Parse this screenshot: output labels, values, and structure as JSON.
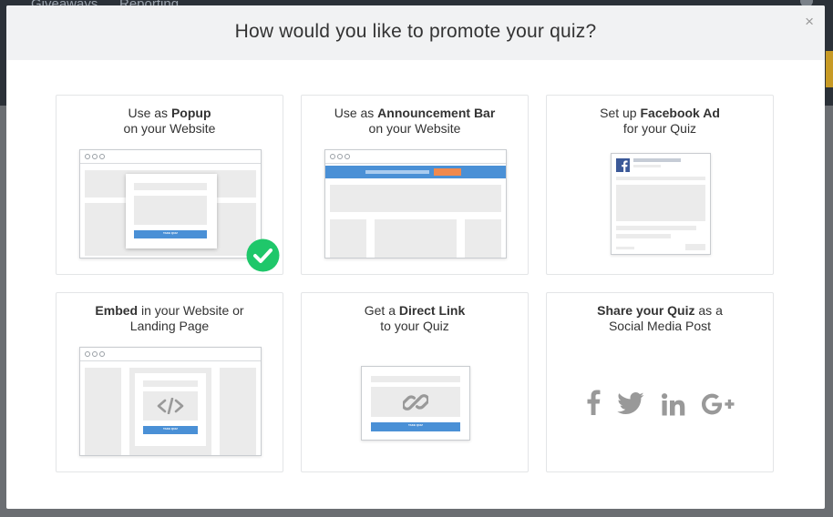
{
  "background": {
    "nav_items": [
      "Giveaways",
      "Reporting"
    ]
  },
  "modal": {
    "title": "How would you like to promote your quiz?",
    "close_label": "×"
  },
  "options": [
    {
      "id": "popup",
      "prefix": "Use as ",
      "bold": "Popup",
      "suffix": "",
      "line2": "on your Website",
      "selected": true,
      "mock_button": "TAKE QUIZ"
    },
    {
      "id": "announcement-bar",
      "prefix": "Use as ",
      "bold": "Announcement Bar",
      "suffix": "",
      "line2": "on your Website",
      "selected": false
    },
    {
      "id": "facebook-ad",
      "prefix": "Set up ",
      "bold": "Facebook Ad",
      "suffix": "",
      "line2": "for your Quiz",
      "selected": false
    },
    {
      "id": "embed",
      "prefix": "",
      "bold": "Embed",
      "suffix": " in your Website or",
      "line2": "Landing Page",
      "selected": false,
      "mock_button": "TAKE QUIZ"
    },
    {
      "id": "direct-link",
      "prefix": "Get a ",
      "bold": "Direct Link",
      "suffix": "",
      "line2": "to your Quiz",
      "selected": false,
      "mock_button": "TAKE QUIZ"
    },
    {
      "id": "social-post",
      "prefix": "",
      "bold": "Share your Quiz",
      "suffix": " as a",
      "line2": "Social Media Post",
      "selected": false
    }
  ],
  "social_icons": [
    "facebook-icon",
    "twitter-icon",
    "linkedin-icon",
    "google-plus-icon"
  ],
  "colors": {
    "accent_blue": "#4a90d6",
    "selected_green": "#1fc76a",
    "announcement_button": "#f0894e",
    "facebook_blue": "#3b5998"
  }
}
